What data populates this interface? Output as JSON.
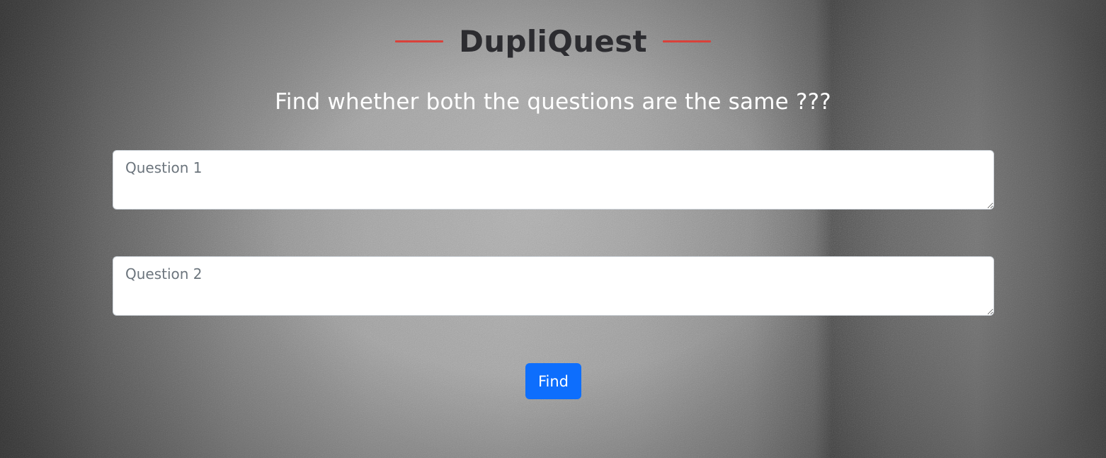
{
  "header": {
    "app_title": "DupliQuest",
    "accent_color": "#d9413a"
  },
  "main": {
    "subtitle": "Find whether both the questions are the same ???",
    "question1": {
      "placeholder": "Question 1",
      "value": ""
    },
    "question2": {
      "placeholder": "Question 2",
      "value": ""
    },
    "find_button_label": "Find",
    "button_color": "#0d6efd"
  }
}
